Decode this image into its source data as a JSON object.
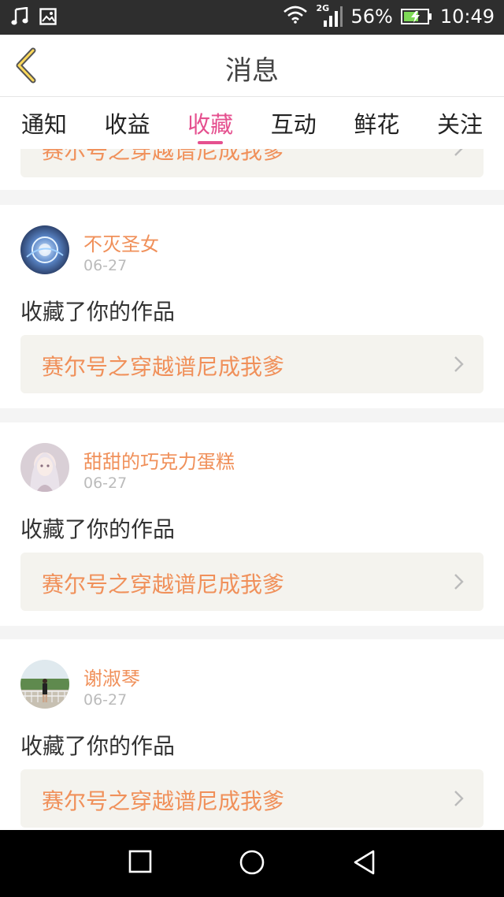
{
  "status": {
    "signal_type": "2G",
    "battery": "56%",
    "time": "10:49"
  },
  "header": {
    "title": "消息"
  },
  "tabs": [
    {
      "label": "通知"
    },
    {
      "label": "收益"
    },
    {
      "label": "收藏"
    },
    {
      "label": "互动"
    },
    {
      "label": "鲜花"
    },
    {
      "label": "关注"
    }
  ],
  "active_tab": "收藏",
  "partial_item": {
    "work_title": "赛尔号之穿越谱尼成我爹"
  },
  "items": [
    {
      "username": "不灭圣女",
      "date": "06-27",
      "action": "收藏了你的作品",
      "work_title": "赛尔号之穿越谱尼成我爹"
    },
    {
      "username": "甜甜的巧克力蛋糕",
      "date": "06-27",
      "action": "收藏了你的作品",
      "work_title": "赛尔号之穿越谱尼成我爹"
    },
    {
      "username": "谢淑琴",
      "date": "06-27",
      "action": "收藏了你的作品",
      "work_title": "赛尔号之穿越谱尼成我爹"
    }
  ],
  "colors": {
    "accent": "#e5508f",
    "username": "#f0905a",
    "work_bg": "#f4f3ee"
  },
  "icons": {
    "status_left": [
      "music-note-icon",
      "image-icon"
    ],
    "status_right": [
      "wifi-icon",
      "signal-icon",
      "battery-icon"
    ],
    "back": "back-chevron-icon",
    "card": "chevron-right-icon",
    "nav": [
      "recent-apps-icon",
      "home-icon",
      "back-triangle-icon"
    ]
  }
}
